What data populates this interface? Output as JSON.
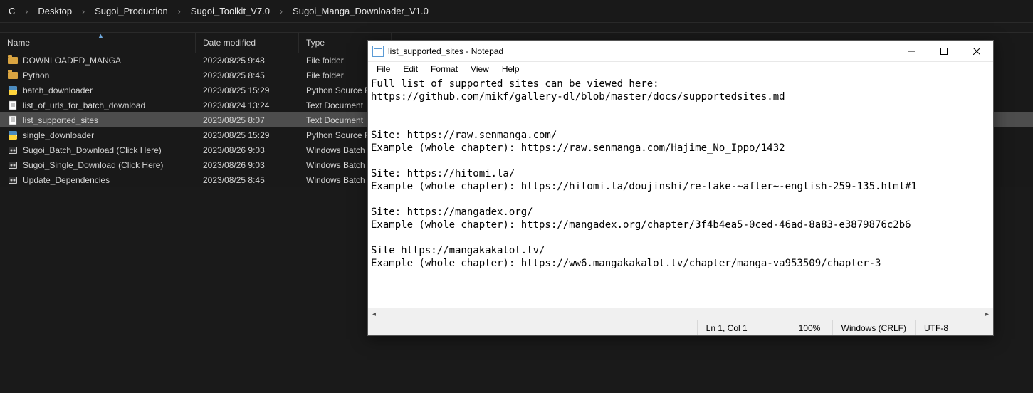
{
  "breadcrumb": [
    "C",
    "Desktop",
    "Sugoi_Production",
    "Sugoi_Toolkit_V7.0",
    "Sugoi_Manga_Downloader_V1.0"
  ],
  "columns": {
    "name": "Name",
    "date": "Date modified",
    "type": "Type"
  },
  "files": [
    {
      "icon": "folder",
      "name": "DOWNLOADED_MANGA",
      "date": "2023/08/25 9:48",
      "type": "File folder",
      "selected": false
    },
    {
      "icon": "folder",
      "name": "Python",
      "date": "2023/08/25 8:45",
      "type": "File folder",
      "selected": false
    },
    {
      "icon": "py",
      "name": "batch_downloader",
      "date": "2023/08/25 15:29",
      "type": "Python Source Fi",
      "selected": false
    },
    {
      "icon": "txt",
      "name": "list_of_urls_for_batch_download",
      "date": "2023/08/24 13:24",
      "type": "Text Document",
      "selected": false
    },
    {
      "icon": "txt",
      "name": "list_supported_sites",
      "date": "2023/08/25 8:07",
      "type": "Text Document",
      "selected": true
    },
    {
      "icon": "py",
      "name": "single_downloader",
      "date": "2023/08/25 15:29",
      "type": "Python Source Fi",
      "selected": false
    },
    {
      "icon": "batch",
      "name": "Sugoi_Batch_Download (Click Here)",
      "date": "2023/08/26 9:03",
      "type": "Windows Batch F",
      "selected": false
    },
    {
      "icon": "batch",
      "name": "Sugoi_Single_Download (Click Here)",
      "date": "2023/08/26 9:03",
      "type": "Windows Batch F",
      "selected": false
    },
    {
      "icon": "batch",
      "name": "Update_Dependencies",
      "date": "2023/08/25 8:45",
      "type": "Windows Batch F",
      "selected": false
    }
  ],
  "notepad": {
    "title": "list_supported_sites - Notepad",
    "menu": [
      "File",
      "Edit",
      "Format",
      "View",
      "Help"
    ],
    "content": "Full list of supported sites can be viewed here:\nhttps://github.com/mikf/gallery-dl/blob/master/docs/supportedsites.md\n\n\nSite: https://raw.senmanga.com/\nExample (whole chapter): https://raw.senmanga.com/Hajime_No_Ippo/1432\n\nSite: https://hitomi.la/\nExample (whole chapter): https://hitomi.la/doujinshi/re-take-~after~-english-259-135.html#1\n\nSite: https://mangadex.org/\nExample (whole chapter): https://mangadex.org/chapter/3f4b4ea5-0ced-46ad-8a83-e3879876c2b6\n\nSite https://mangakakalot.tv/\nExample (whole chapter): https://ww6.mangakakalot.tv/chapter/manga-va953509/chapter-3",
    "status": {
      "lncol": "Ln 1, Col 1",
      "zoom": "100%",
      "eol": "Windows (CRLF)",
      "encoding": "UTF-8"
    }
  }
}
